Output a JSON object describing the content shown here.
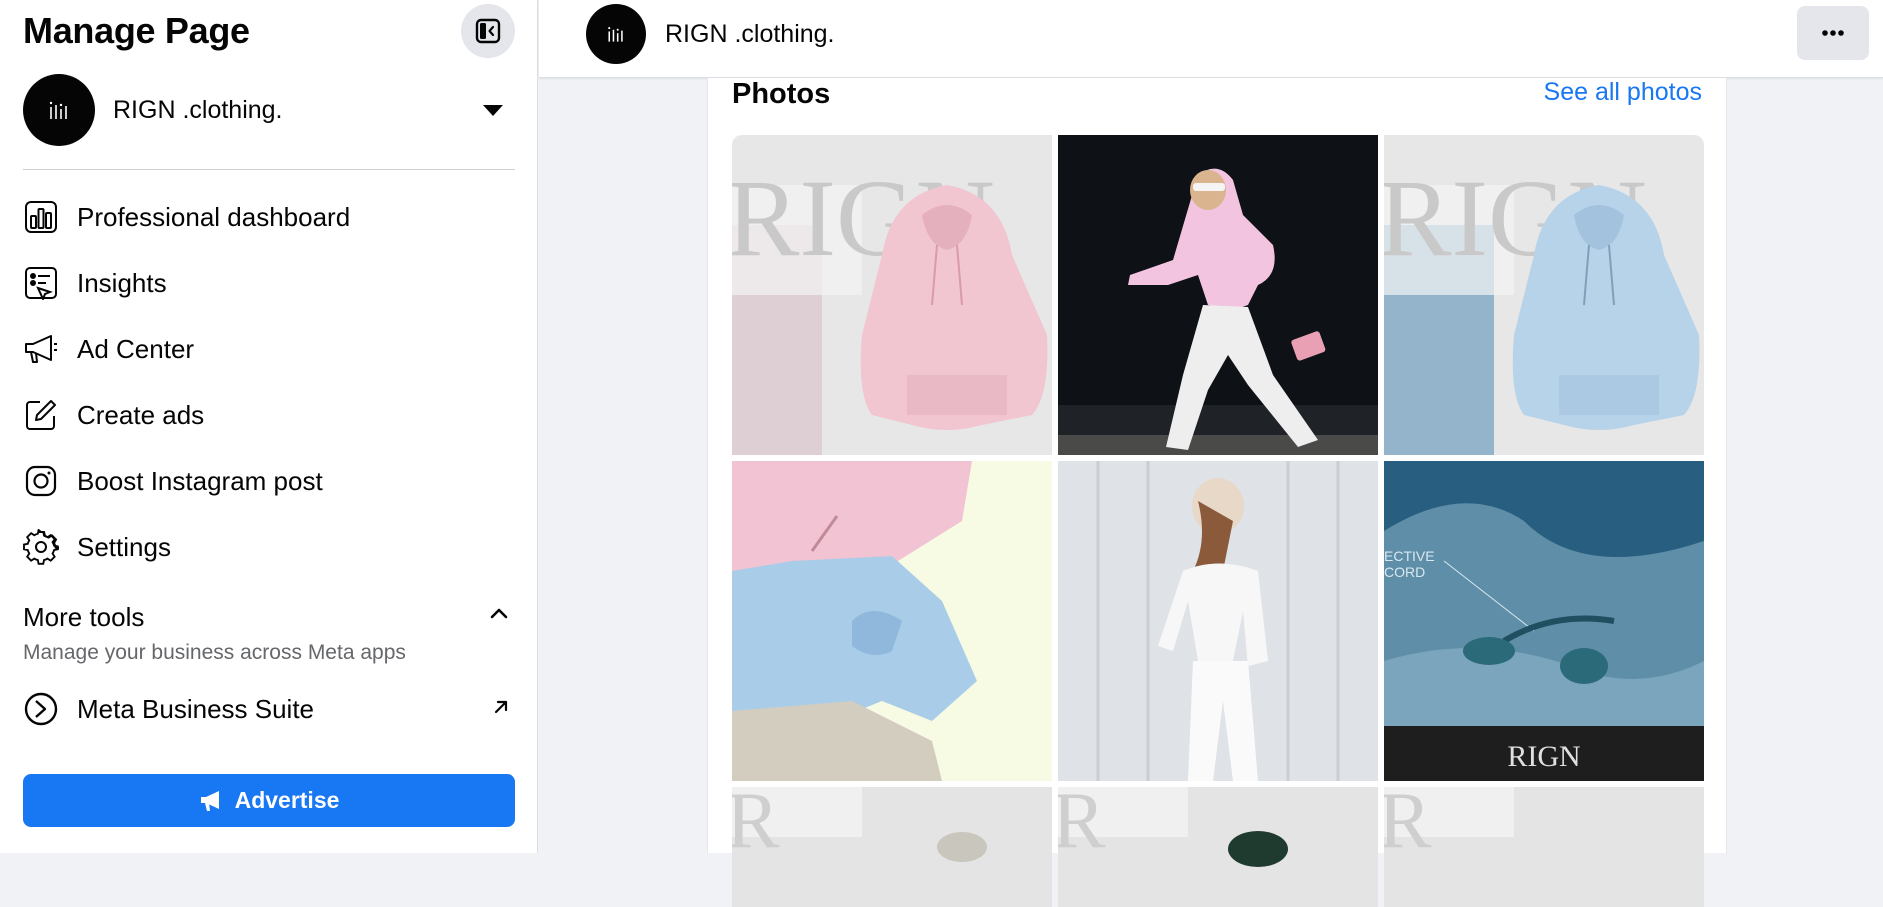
{
  "sidebar": {
    "title": "Manage Page",
    "page_name": "RIGN .clothing.",
    "nav_items": [
      {
        "label": "Professional dashboard",
        "icon": "bar-chart-icon"
      },
      {
        "label": "Insights",
        "icon": "insights-icon"
      },
      {
        "label": "Ad Center",
        "icon": "megaphone-icon"
      },
      {
        "label": "Create ads",
        "icon": "pencil-square-icon"
      },
      {
        "label": "Boost Instagram post",
        "icon": "instagram-icon"
      },
      {
        "label": "Settings",
        "icon": "gear-icon"
      }
    ],
    "more_tools": {
      "title": "More tools",
      "subtitle": "Manage your business across Meta apps"
    },
    "meta_business_suite": "Meta Business Suite",
    "advertise_label": "Advertise"
  },
  "topbar": {
    "page_name": "RIGN .clothing."
  },
  "photos": {
    "title": "Photos",
    "see_all": "See all photos",
    "tiles": [
      {
        "description_icon": "pink-hoodie-photo"
      },
      {
        "description_icon": "person-walking-pink-hoodie-photo"
      },
      {
        "description_icon": "blue-hoodie-photo"
      },
      {
        "description_icon": "pink-blue-hoodies-flatlay-photo"
      },
      {
        "description_icon": "person-white-outfit-photo"
      },
      {
        "description_icon": "drawstring-closeup-photo"
      },
      {
        "description_icon": "hoodie-photo"
      },
      {
        "description_icon": "hoodie-photo"
      },
      {
        "description_icon": "hoodie-photo"
      }
    ],
    "tile_text": {
      "rign_logo": "RIGN",
      "effective_record": "ECTIVE\nCORD"
    }
  },
  "colors": {
    "accent": "#1877f2",
    "background": "#f0f2f5",
    "text_primary": "#050505",
    "text_secondary": "#65676b"
  }
}
